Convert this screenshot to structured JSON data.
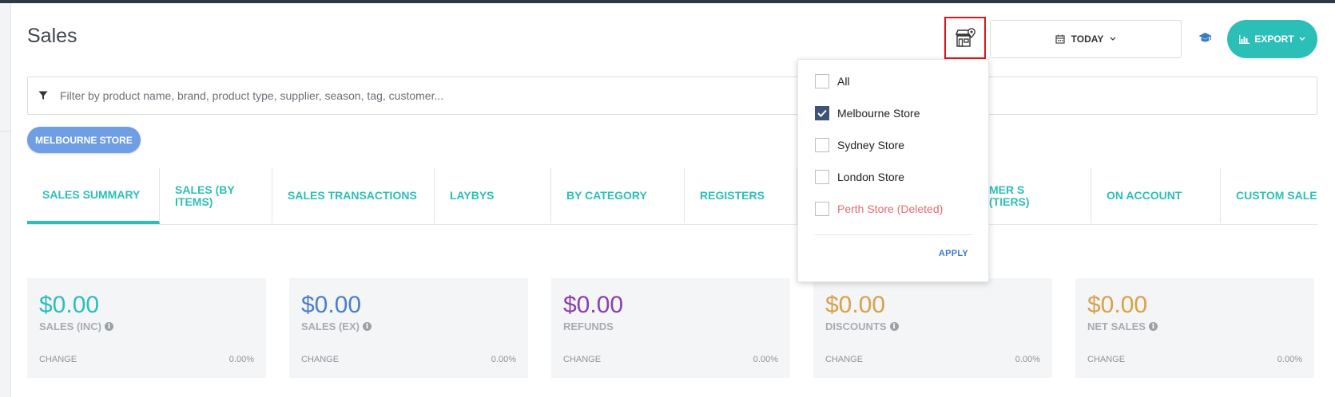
{
  "page": {
    "title": "Sales"
  },
  "toolbar": {
    "store_icon": "store-location-icon",
    "date_label": "TODAY",
    "export_label": "EXPORT"
  },
  "filter": {
    "placeholder": "Filter by product name, brand, product type, supplier, season, tag, customer..."
  },
  "chip": {
    "label": "MELBOURNE STORE"
  },
  "tabs": [
    {
      "label": "SALES SUMMARY",
      "active": true
    },
    {
      "label": "SALES (BY ITEMS)"
    },
    {
      "label": "SALES TRANSACTIONS"
    },
    {
      "label": "LAYBYS"
    },
    {
      "label": "BY CATEGORY"
    },
    {
      "label": "REGISTERS"
    },
    {
      "label": ""
    },
    {
      "label": "MER S (TIERS)"
    },
    {
      "label": "ON ACCOUNT"
    },
    {
      "label": "CUSTOM SALE"
    }
  ],
  "cards": [
    {
      "value": "$0.00",
      "label": "SALES (INC)",
      "info": true,
      "change_label": "CHANGE",
      "change": "0.00%",
      "color": "#2cbfb8"
    },
    {
      "value": "$0.00",
      "label": "SALES (EX)",
      "info": true,
      "change_label": "CHANGE",
      "change": "0.00%",
      "color": "#4d7fc7"
    },
    {
      "value": "$0.00",
      "label": "REFUNDS",
      "info": false,
      "change_label": "CHANGE",
      "change": "0.00%",
      "color": "#8a3fae"
    },
    {
      "value": "$0.00",
      "label": "DISCOUNTS",
      "info": true,
      "change_label": "CHANGE",
      "change": "0.00%",
      "color": "#d7a24a"
    },
    {
      "value": "$0.00",
      "label": "NET SALES",
      "info": true,
      "change_label": "CHANGE",
      "change": "0.00%",
      "color": "#d7a24a"
    }
  ],
  "store_dropdown": {
    "options": [
      {
        "label": "All",
        "checked": false
      },
      {
        "label": "Melbourne Store",
        "checked": true
      },
      {
        "label": "Sydney Store",
        "checked": false
      },
      {
        "label": "London Store",
        "checked": false
      },
      {
        "label": "Perth Store (Deleted)",
        "checked": false,
        "deleted": true
      }
    ],
    "apply_label": "APPLY"
  },
  "colors": {
    "accent": "#2cbfb8",
    "chip": "#6f9ee4",
    "checkbox_checked": "#3d5474",
    "deleted": "#e46a72",
    "highlight_border": "#e0141a"
  }
}
